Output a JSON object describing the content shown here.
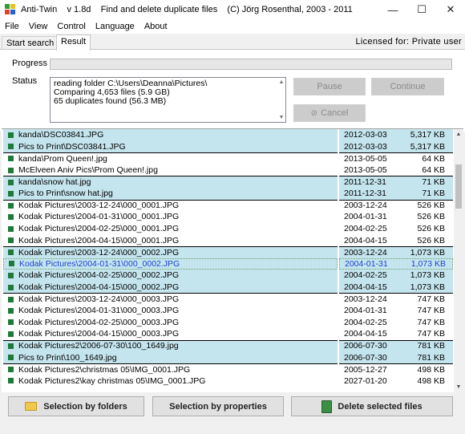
{
  "window": {
    "title": "Anti-Twin    v 1.8d    Find and delete duplicate files    (C) Jörg Rosenthal, 2003 - 2011",
    "controls": [
      "—",
      "☐",
      "✕"
    ]
  },
  "menu": [
    "File",
    "View",
    "Control",
    "Language",
    "About"
  ],
  "tabs": [
    {
      "label": "Start search",
      "active": false
    },
    {
      "label": "Result",
      "active": true
    }
  ],
  "licensed": "Licensed for: Private user",
  "progress": {
    "label": "Progress",
    "value": 0
  },
  "status": {
    "label": "Status",
    "lines": [
      "reading folder C:\\Users\\Deanna\\Pictures\\",
      "Comparing 4,653 files (5.9 GB)",
      "65 duplicates found (56.3 MB)"
    ]
  },
  "buttons": {
    "pause": "Pause",
    "continue": "Continue",
    "cancel": "Cancel"
  },
  "files": [
    {
      "name": "kanda\\DSC03841.JPG",
      "date": "2012-03-03",
      "size": "5,317 KB",
      "hl": true,
      "grp": true
    },
    {
      "name": "Pics to Print\\DSC03841.JPG",
      "date": "2012-03-03",
      "size": "5,317 KB",
      "hl": true,
      "grp": false
    },
    {
      "name": "kanda\\Prom Queen!.jpg",
      "date": "2013-05-05",
      "size": "64 KB",
      "hl": false,
      "grp": true
    },
    {
      "name": "McElveen Aniv Pics\\Prom Queen!.jpg",
      "date": "2013-05-05",
      "size": "64 KB",
      "hl": false,
      "grp": false
    },
    {
      "name": "kanda\\snow hat.jpg",
      "date": "2011-12-31",
      "size": "71 KB",
      "hl": true,
      "grp": true
    },
    {
      "name": "Pics to Print\\snow hat.jpg",
      "date": "2011-12-31",
      "size": "71 KB",
      "hl": true,
      "grp": false
    },
    {
      "name": "Kodak Pictures\\2003-12-24\\000_0001.JPG",
      "date": "2003-12-24",
      "size": "526 KB",
      "hl": false,
      "grp": true
    },
    {
      "name": "Kodak Pictures\\2004-01-31\\000_0001.JPG",
      "date": "2004-01-31",
      "size": "526 KB",
      "hl": false,
      "grp": false
    },
    {
      "name": "Kodak Pictures\\2004-02-25\\000_0001.JPG",
      "date": "2004-02-25",
      "size": "526 KB",
      "hl": false,
      "grp": false
    },
    {
      "name": "Kodak Pictures\\2004-04-15\\000_0001.JPG",
      "date": "2004-04-15",
      "size": "526 KB",
      "hl": false,
      "grp": false
    },
    {
      "name": "Kodak Pictures\\2003-12-24\\000_0002.JPG",
      "date": "2003-12-24",
      "size": "1,073 KB",
      "hl": true,
      "grp": true
    },
    {
      "name": "Kodak Pictures\\2004-01-31\\000_0002.JPG",
      "date": "2004-01-31",
      "size": "1,073 KB",
      "hl": true,
      "grp": false,
      "sel": true
    },
    {
      "name": "Kodak Pictures\\2004-02-25\\000_0002.JPG",
      "date": "2004-02-25",
      "size": "1,073 KB",
      "hl": true,
      "grp": false
    },
    {
      "name": "Kodak Pictures\\2004-04-15\\000_0002.JPG",
      "date": "2004-04-15",
      "size": "1,073 KB",
      "hl": true,
      "grp": false
    },
    {
      "name": "Kodak Pictures\\2003-12-24\\000_0003.JPG",
      "date": "2003-12-24",
      "size": "747 KB",
      "hl": false,
      "grp": true
    },
    {
      "name": "Kodak Pictures\\2004-01-31\\000_0003.JPG",
      "date": "2004-01-31",
      "size": "747 KB",
      "hl": false,
      "grp": false
    },
    {
      "name": "Kodak Pictures\\2004-02-25\\000_0003.JPG",
      "date": "2004-02-25",
      "size": "747 KB",
      "hl": false,
      "grp": false
    },
    {
      "name": "Kodak Pictures\\2004-04-15\\000_0003.JPG",
      "date": "2004-04-15",
      "size": "747 KB",
      "hl": false,
      "grp": false
    },
    {
      "name": "Kodak Pictures2\\2006-07-30\\100_1649.jpg",
      "date": "2006-07-30",
      "size": "781 KB",
      "hl": true,
      "grp": true
    },
    {
      "name": "Pics to Print\\100_1649.jpg",
      "date": "2006-07-30",
      "size": "781 KB",
      "hl": true,
      "grp": false
    },
    {
      "name": "Kodak Pictures2\\christmas 05\\IMG_0001.JPG",
      "date": "2005-12-27",
      "size": "498 KB",
      "hl": false,
      "grp": true
    },
    {
      "name": "Kodak Pictures2\\kay christmas 05\\IMG_0001.JPG",
      "date": "2027-01-20",
      "size": "498 KB",
      "hl": false,
      "grp": false
    }
  ],
  "bottom": {
    "by_folders": "Selection by folders",
    "by_properties": "Selection by properties",
    "delete": "Delete selected files"
  },
  "colors": {
    "highlight": "#c5e5ee",
    "marker": "#1f7a3a",
    "selected_text": "#1c3fd0"
  }
}
